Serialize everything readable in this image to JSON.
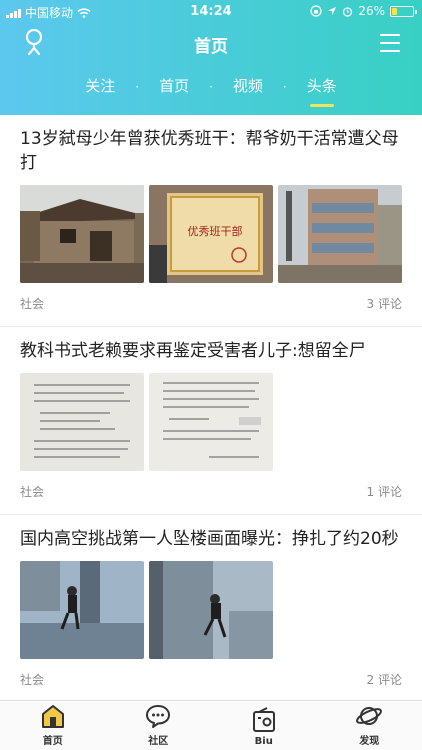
{
  "status_bar": {
    "carrier": "中国移动",
    "time": "14:24",
    "battery": "26%",
    "battery_level": 0.26
  },
  "header": {
    "title": "首页",
    "tabs": [
      {
        "label": "关注",
        "active": false
      },
      {
        "label": "首页",
        "active": false
      },
      {
        "label": "视频",
        "active": false
      },
      {
        "label": "头条",
        "active": true
      }
    ],
    "separator": "·"
  },
  "articles": [
    {
      "title": "13岁弑母少年曾获优秀班干：帮爷奶干活常遭父母打",
      "category": "社会",
      "comments": "3 评论",
      "certificate_text": "优秀班干部"
    },
    {
      "title": "教科书式老赖要求再鉴定受害者儿子:想留全尸",
      "category": "社会",
      "comments": "1 评论"
    },
    {
      "title": "国内高空挑战第一人坠楼画面曝光：挣扎了约20秒",
      "category": "社会",
      "comments": "2 评论"
    }
  ],
  "tabbar": {
    "items": [
      {
        "label": "首页",
        "icon": "home-icon"
      },
      {
        "label": "社区",
        "icon": "chat-bubble-icon"
      },
      {
        "label": "Biu",
        "icon": "radio-icon"
      },
      {
        "label": "发现",
        "icon": "planet-icon"
      }
    ]
  },
  "colors": {
    "header_start": "#5cc8ee",
    "header_end": "#38d0c4",
    "tab_indicator": "#f2e45a",
    "battery_fill": "#f5e642"
  }
}
